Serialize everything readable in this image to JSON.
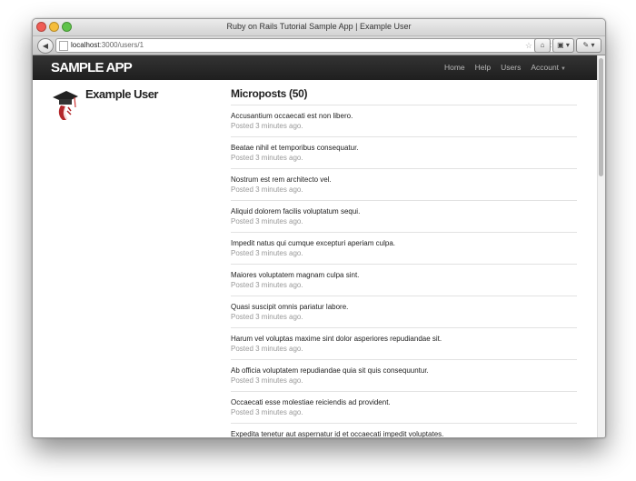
{
  "window": {
    "title": "Ruby on Rails Tutorial Sample App | Example User"
  },
  "browser": {
    "url_host": "localhost",
    "url_path": ":3000/users/1",
    "back_glyph": "◀",
    "star_glyph": "☆ ▿",
    "reload_glyph": "C",
    "home_glyph": "⌂",
    "display_glyph": "▣ ▾",
    "tools_glyph": "✎ ▾"
  },
  "navbar": {
    "brand": "SAMPLE APP",
    "links": [
      "Home",
      "Help",
      "Users",
      "Account"
    ],
    "account_caret": "▼"
  },
  "user": {
    "name": "Example User",
    "avatar_icon": "rails-graduate-icon"
  },
  "microposts": {
    "heading": "Microposts (50)",
    "items": [
      {
        "content": "Accusantium occaecati est non libero.",
        "time": "Posted 3 minutes ago."
      },
      {
        "content": "Beatae nihil et temporibus consequatur.",
        "time": "Posted 3 minutes ago."
      },
      {
        "content": "Nostrum est rem architecto vel.",
        "time": "Posted 3 minutes ago."
      },
      {
        "content": "Aliquid dolorem facilis voluptatum sequi.",
        "time": "Posted 3 minutes ago."
      },
      {
        "content": "Impedit natus qui cumque excepturi aperiam culpa.",
        "time": "Posted 3 minutes ago."
      },
      {
        "content": "Maiores voluptatem magnam culpa sint.",
        "time": "Posted 3 minutes ago."
      },
      {
        "content": "Quasi suscipit omnis pariatur labore.",
        "time": "Posted 3 minutes ago."
      },
      {
        "content": "Harum vel voluptas maxime sint dolor asperiores repudiandae sit.",
        "time": "Posted 3 minutes ago."
      },
      {
        "content": "Ab officia voluptatem repudiandae quia sit quis consequuntur.",
        "time": "Posted 3 minutes ago."
      },
      {
        "content": "Occaecati esse molestiae reiciendis ad provident.",
        "time": "Posted 3 minutes ago."
      },
      {
        "content": "Expedita tenetur aut aspernatur id et occaecati impedit voluptates.",
        "time": ""
      }
    ]
  }
}
